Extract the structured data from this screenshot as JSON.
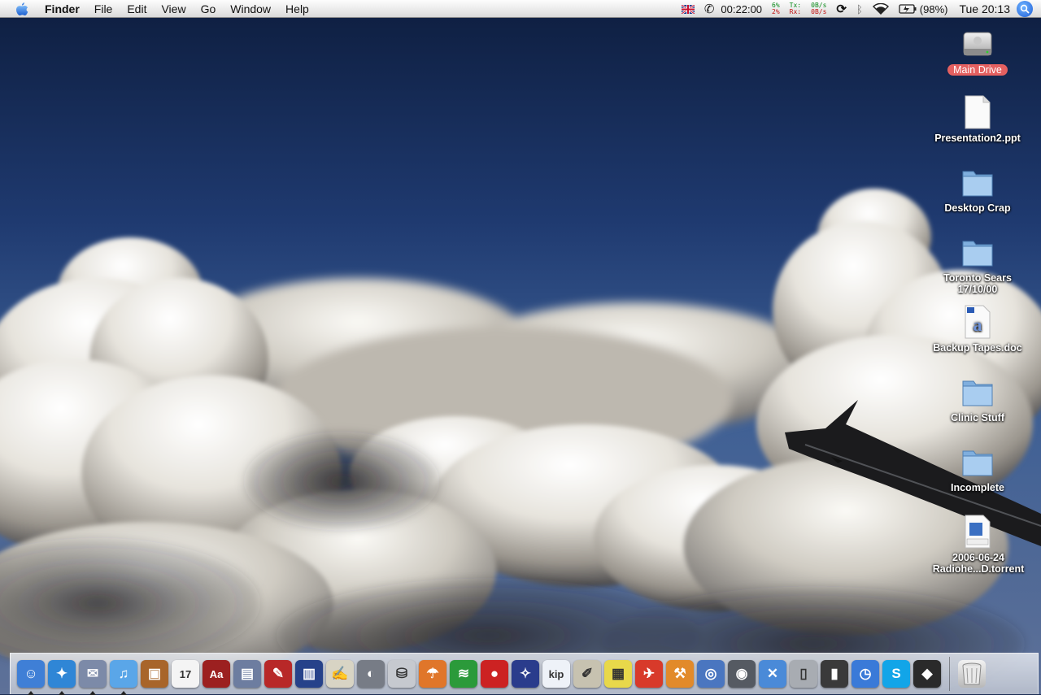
{
  "menubar": {
    "app_name": "Finder",
    "menus": [
      "File",
      "Edit",
      "View",
      "Go",
      "Window",
      "Help"
    ],
    "status": {
      "timer": "00:22:00",
      "cpu_top": "6%",
      "cpu_bottom": "2%",
      "tx_label": "Tx:",
      "rx_label": "Rx:",
      "tx_rate": "0B/s",
      "rx_rate": "0B/s",
      "battery": "(98%)",
      "clock": "Tue 20:13"
    }
  },
  "desktop": {
    "icons": [
      {
        "label": "Main Drive",
        "icon": "hard-drive-icon",
        "selected": true
      },
      {
        "label": "Presentation2.ppt",
        "icon": "document-icon"
      },
      {
        "label": "Desktop Crap",
        "icon": "folder-icon"
      },
      {
        "label": "Toronto Sears 17/10/00",
        "icon": "folder-icon"
      },
      {
        "label": "Backup Tapes.doc",
        "icon": "word-document-icon"
      },
      {
        "label": "Clinic Stuff",
        "icon": "folder-icon"
      },
      {
        "label": "Incomplete",
        "icon": "folder-icon"
      },
      {
        "label": "2006-06-24 Radiohe...D.torrent",
        "icon": "torrent-file-icon"
      }
    ]
  },
  "dock": {
    "items": [
      {
        "name": "finder-icon",
        "glyph": "☺",
        "color": "#3f7fd6",
        "running": true
      },
      {
        "name": "safari-icon",
        "glyph": "✦",
        "color": "#2f86d6",
        "running": true
      },
      {
        "name": "mail-icon",
        "glyph": "✉",
        "color": "#7c8aa8",
        "running": true
      },
      {
        "name": "itunes-icon",
        "glyph": "♫",
        "color": "#5aa6e8",
        "running": true
      },
      {
        "name": "iphoto-icon",
        "glyph": "▣",
        "color": "#a8652a"
      },
      {
        "name": "ical-icon",
        "glyph": "17",
        "color": "#f4f4f4"
      },
      {
        "name": "dictionary-icon",
        "glyph": "Aa",
        "color": "#9c2020"
      },
      {
        "name": "address-book-icon",
        "glyph": "▤",
        "color": "#6d7da0"
      },
      {
        "name": "red-book-icon",
        "glyph": "✎",
        "color": "#b82828"
      },
      {
        "name": "pdf-book-icon",
        "glyph": "▥",
        "color": "#26428a"
      },
      {
        "name": "textedit-icon",
        "glyph": "✍",
        "color": "#d8d4c4"
      },
      {
        "name": "directory-utility-icon",
        "glyph": "◐",
        "color": "#777c86"
      },
      {
        "name": "disk-utility-icon",
        "glyph": "⛁",
        "color": "#c6c9cf"
      },
      {
        "name": "umbrella-icon",
        "glyph": "☂",
        "color": "#e0762a"
      },
      {
        "name": "network-icon",
        "glyph": "≋",
        "color": "#2b9a3a"
      },
      {
        "name": "red-hat-icon",
        "glyph": "●",
        "color": "#cc2222"
      },
      {
        "name": "constellation-icon",
        "glyph": "✧",
        "color": "#2a3c8c"
      },
      {
        "name": "kip-icon",
        "glyph": "kip",
        "color": "#eef2f8"
      },
      {
        "name": "script-editor-icon",
        "glyph": "✐",
        "color": "#c7c2b0"
      },
      {
        "name": "stickies-icon",
        "glyph": "▦",
        "color": "#e8d84a"
      },
      {
        "name": "hair-dryer-icon",
        "glyph": "✈",
        "color": "#d83a2a"
      },
      {
        "name": "tool-icon",
        "glyph": "⚒",
        "color": "#e28a2a"
      },
      {
        "name": "internet-connect-icon",
        "glyph": "◎",
        "color": "#4a76c0"
      },
      {
        "name": "dvd-player-icon",
        "glyph": "◉",
        "color": "#555a62"
      },
      {
        "name": "xcode-icon",
        "glyph": "✕",
        "color": "#4a8ad8"
      },
      {
        "name": "phone-icon",
        "glyph": "▯",
        "color": "#a8acb2"
      },
      {
        "name": "film-icon",
        "glyph": "▮",
        "color": "#3a3a3a"
      },
      {
        "name": "alarm-clock-icon",
        "glyph": "◷",
        "color": "#3a7ad8"
      },
      {
        "name": "skype-icon",
        "glyph": "S",
        "color": "#12a5e8"
      },
      {
        "name": "ink-drop-icon",
        "glyph": "◆",
        "color": "#2a2a2a"
      }
    ],
    "trash": {
      "name": "trash-icon",
      "glyph": "🗑"
    }
  }
}
